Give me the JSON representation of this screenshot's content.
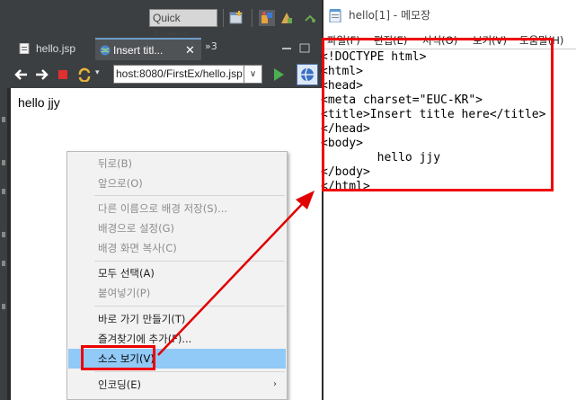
{
  "eclipse": {
    "quick_access": "Quick Access",
    "tabs": [
      {
        "label": "hello.jsp"
      },
      {
        "label": "Insert titl..."
      }
    ],
    "tab_close": "✕",
    "tab_overflow": "»3",
    "url": "host:8080/FirstEx/hello.jsp"
  },
  "browser": {
    "content": "hello jjy"
  },
  "context_menu": {
    "items": [
      {
        "label": "뒤로(B)",
        "enabled": false
      },
      {
        "label": "앞으로(O)",
        "enabled": false
      },
      {
        "label": "다른 이름으로 배경 저장(S)...",
        "enabled": false
      },
      {
        "label": "배경으로 설정(G)",
        "enabled": false
      },
      {
        "label": "배경 화면 복사(C)",
        "enabled": false
      },
      {
        "label": "모두 선택(A)",
        "enabled": true
      },
      {
        "label": "붙여넣기(P)",
        "enabled": false
      },
      {
        "label": "바로 가기 만들기(T)",
        "enabled": true
      },
      {
        "label": "즐겨찾기에 추가(F)...",
        "enabled": true
      },
      {
        "label": "소스 보기(V)",
        "enabled": true,
        "highlighted": true
      },
      {
        "label": "인코딩(E)",
        "enabled": true,
        "submenu": true
      }
    ]
  },
  "notepad": {
    "title": "hello[1] - 메모장",
    "menu": [
      "파일(F)",
      "편집(E)",
      "서식(O)",
      "보기(V)",
      "도움말(H)"
    ],
    "lines": [
      "<!DOCTYPE html>",
      "<html>",
      "<head>",
      "<meta charset=\"EUC-KR\">",
      "<title>Insert title here</title>",
      "</head>",
      "<body>",
      "        hello jjy",
      "</body>",
      "</html>"
    ]
  },
  "colors": {
    "annotation": "#e00000",
    "highlight": "#91c9f7",
    "eclipse_bg": "#3c3f41"
  }
}
